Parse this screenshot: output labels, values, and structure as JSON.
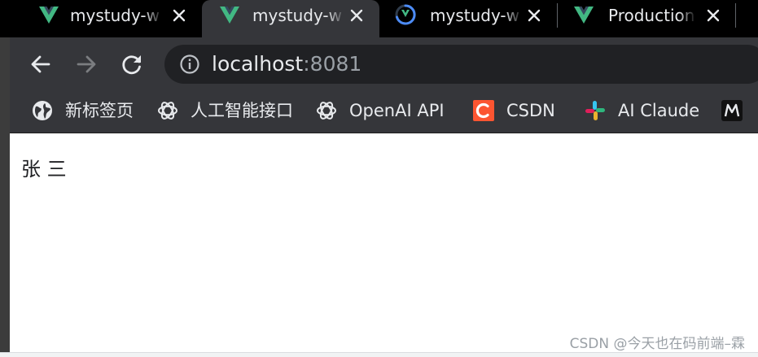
{
  "tabs": [
    {
      "title": "mystudy-w",
      "icon": "vue-logo-icon",
      "active": false
    },
    {
      "title": "mystudy-w",
      "icon": "vue-logo-icon",
      "active": true
    },
    {
      "title": "mystudy-w",
      "icon": "loading-spinner-icon",
      "active": false
    },
    {
      "title": "Production",
      "icon": "vue-logo-icon",
      "active": false
    }
  ],
  "omnibox": {
    "host": "localhost",
    "port": ":8081"
  },
  "bookmarks": [
    {
      "label": "新标签页",
      "icon": "globe-icon"
    },
    {
      "label": "人工智能接口",
      "icon": "openai-icon"
    },
    {
      "label": "OpenAI API",
      "icon": "openai-icon"
    },
    {
      "label": "CSDN",
      "icon": "csdn-icon"
    },
    {
      "label": "AI Claude",
      "icon": "slack-icon"
    },
    {
      "label": "",
      "icon": "m-logo-icon"
    }
  ],
  "page": {
    "name": "张 三"
  },
  "watermark": "CSDN @今天也在码前端–霖",
  "colors": {
    "vue_green": "#42b883",
    "vue_dark": "#35495e",
    "tab_bg": "#000000",
    "active_tab_bg": "#35363a",
    "csdn_red": "#fc5531"
  }
}
